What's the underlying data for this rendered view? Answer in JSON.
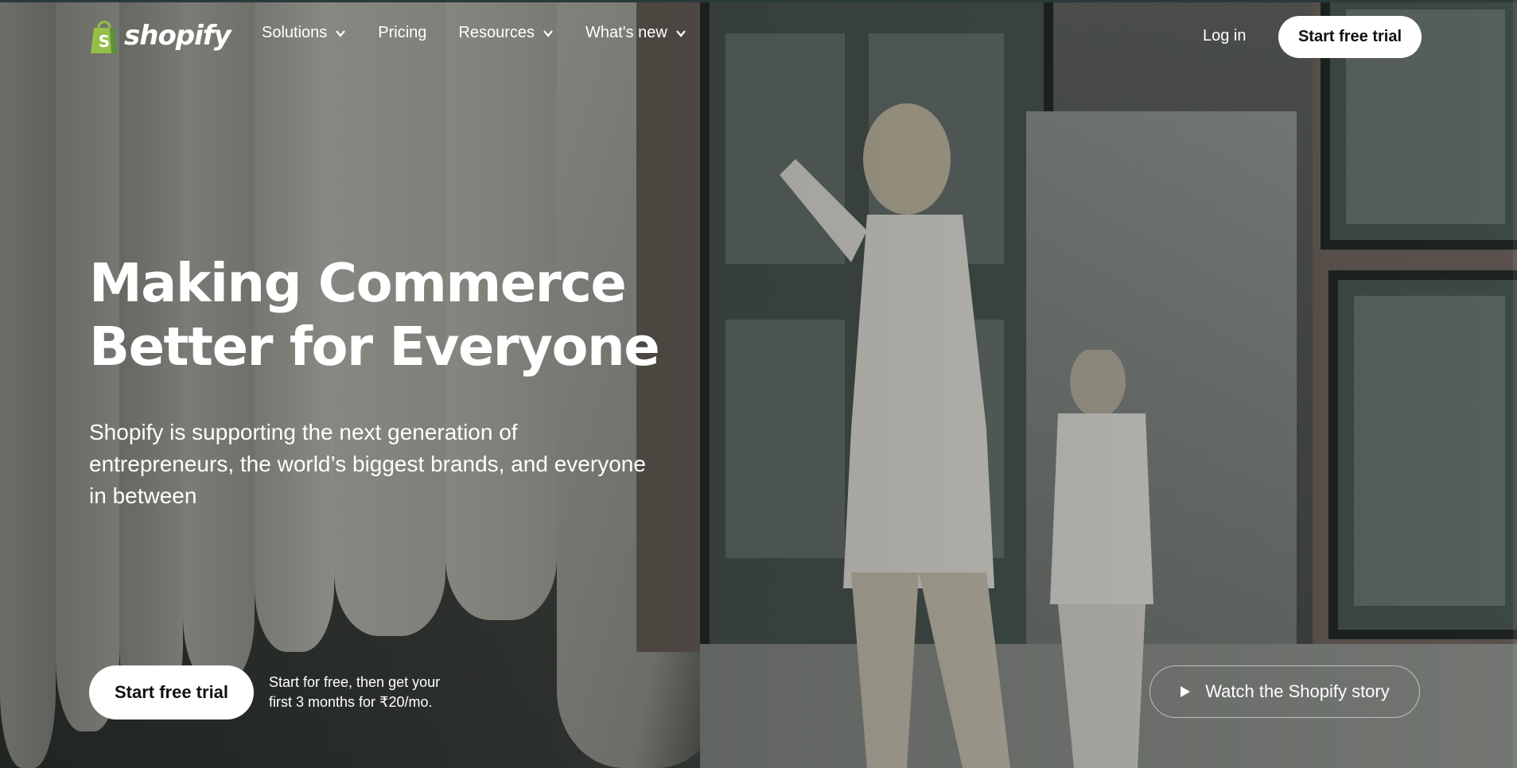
{
  "brand": {
    "name": "shopify",
    "color": "#95bf47"
  },
  "nav": {
    "items": [
      {
        "label": "Solutions",
        "has_dropdown": true
      },
      {
        "label": "Pricing",
        "has_dropdown": false
      },
      {
        "label": "Resources",
        "has_dropdown": true
      },
      {
        "label": "What's new",
        "has_dropdown": true
      }
    ],
    "login": "Log in",
    "trial_button": "Start free trial"
  },
  "hero": {
    "title_line1": "Making Commerce",
    "title_line2": "Better for Everyone",
    "subtitle": "Shopify is supporting the next generation of entrepreneurs, the world’s biggest brands, and everyone in between",
    "cta": "Start free trial",
    "note_line1": "Start for free, then get your",
    "note_line2": "first 3 months for ₹20/mo.",
    "watch_button": "Watch the Shopify story"
  },
  "icons": {
    "logo": "shopping-bag-icon",
    "dropdown": "chevron-down-icon",
    "play": "play-icon"
  }
}
